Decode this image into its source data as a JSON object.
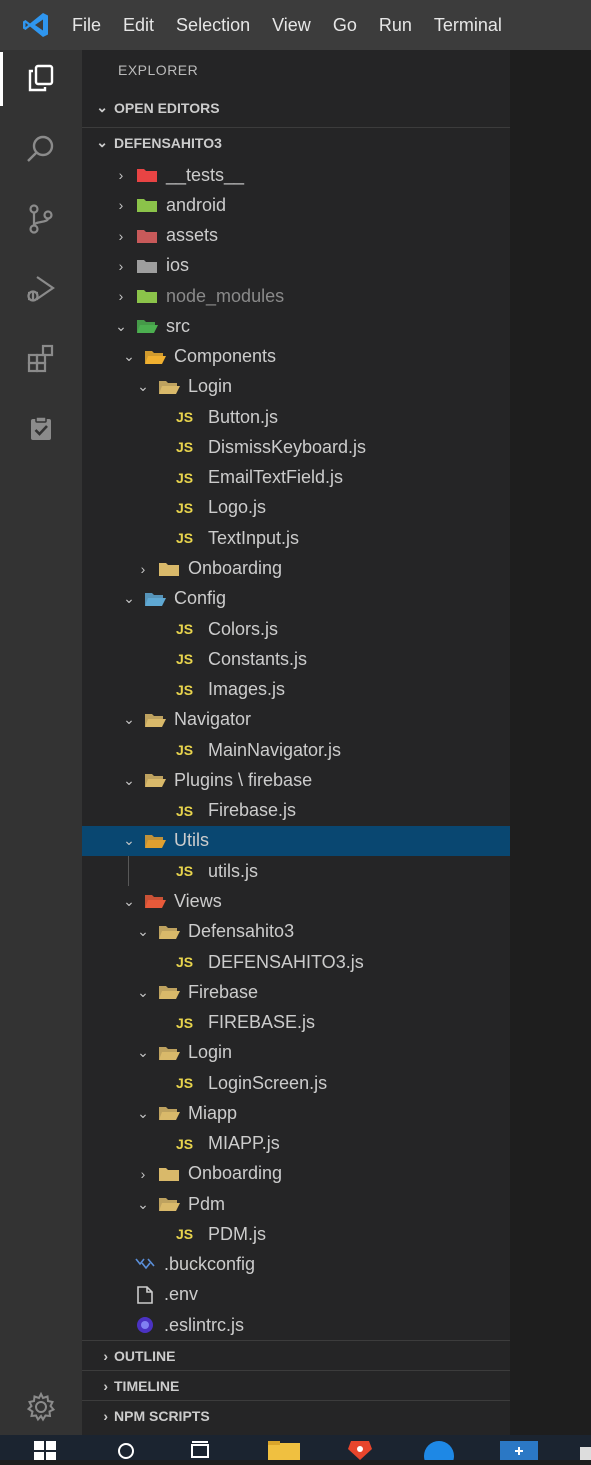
{
  "menubar": {
    "items": [
      "File",
      "Edit",
      "Selection",
      "View",
      "Go",
      "Run",
      "Terminal"
    ]
  },
  "activitybar": {
    "items": [
      "explorer-icon",
      "search-icon",
      "source-control-icon",
      "run-debug-icon",
      "extensions-icon",
      "checklist-icon"
    ],
    "bottom": "settings-gear-icon"
  },
  "sidebar": {
    "title": "EXPLORER",
    "open_editors": "OPEN EDITORS",
    "project": "DEFENSAHITO3",
    "tree": [
      {
        "label": "__tests__",
        "depth": 0,
        "kind": "folder",
        "expanded": false,
        "color": "#e84444"
      },
      {
        "label": "android",
        "depth": 0,
        "kind": "folder",
        "expanded": false,
        "color": "#8bc34a"
      },
      {
        "label": "assets",
        "depth": 0,
        "kind": "folder",
        "expanded": false,
        "color": "#c85a5a"
      },
      {
        "label": "ios",
        "depth": 0,
        "kind": "folder",
        "expanded": false,
        "color": "#9e9e9e"
      },
      {
        "label": "node_modules",
        "depth": 0,
        "kind": "folder",
        "expanded": false,
        "color": "#8bc34a",
        "dim": true
      },
      {
        "label": "src",
        "depth": 0,
        "kind": "folder",
        "expanded": true,
        "color": "#4caf50"
      },
      {
        "label": "Components",
        "depth": 1,
        "kind": "folder",
        "expanded": true,
        "color": "#f0b030"
      },
      {
        "label": "Login",
        "depth": 2,
        "kind": "folder",
        "expanded": true,
        "color": "#d9b96a"
      },
      {
        "label": "Button.js",
        "depth": 3,
        "kind": "js"
      },
      {
        "label": "DismissKeyboard.js",
        "depth": 3,
        "kind": "js"
      },
      {
        "label": "EmailTextField.js",
        "depth": 3,
        "kind": "js"
      },
      {
        "label": "Logo.js",
        "depth": 3,
        "kind": "js"
      },
      {
        "label": "TextInput.js",
        "depth": 3,
        "kind": "js"
      },
      {
        "label": "Onboarding",
        "depth": 2,
        "kind": "folder",
        "expanded": false,
        "color": "#d9b96a"
      },
      {
        "label": "Config",
        "depth": 1,
        "kind": "folder",
        "expanded": true,
        "color": "#5fa8d3"
      },
      {
        "label": "Colors.js",
        "depth": 2,
        "kind": "js"
      },
      {
        "label": "Constants.js",
        "depth": 2,
        "kind": "js"
      },
      {
        "label": "Images.js",
        "depth": 2,
        "kind": "js"
      },
      {
        "label": "Navigator",
        "depth": 1,
        "kind": "folder",
        "expanded": true,
        "color": "#d9b96a"
      },
      {
        "label": "MainNavigator.js",
        "depth": 2,
        "kind": "js"
      },
      {
        "label": "Plugins \\ firebase",
        "depth": 1,
        "kind": "folder",
        "expanded": true,
        "color": "#d9b96a"
      },
      {
        "label": "Firebase.js",
        "depth": 2,
        "kind": "js"
      },
      {
        "label": "Utils",
        "depth": 1,
        "kind": "folder",
        "expanded": true,
        "color": "#e0a030",
        "selected": true
      },
      {
        "label": "utils.js",
        "depth": 2,
        "kind": "js"
      },
      {
        "label": "Views",
        "depth": 1,
        "kind": "folder",
        "expanded": true,
        "color": "#e85a3a"
      },
      {
        "label": "Defensahito3",
        "depth": 2,
        "kind": "folder",
        "expanded": true,
        "color": "#d9b96a"
      },
      {
        "label": "DEFENSAHITO3.js",
        "depth": 3,
        "kind": "js"
      },
      {
        "label": "Firebase",
        "depth": 2,
        "kind": "folder",
        "expanded": true,
        "color": "#d9b96a"
      },
      {
        "label": "FIREBASE.js",
        "depth": 3,
        "kind": "js"
      },
      {
        "label": "Login",
        "depth": 2,
        "kind": "folder",
        "expanded": true,
        "color": "#d9b96a"
      },
      {
        "label": "LoginScreen.js",
        "depth": 3,
        "kind": "js"
      },
      {
        "label": "Miapp",
        "depth": 2,
        "kind": "folder",
        "expanded": true,
        "color": "#d9b96a"
      },
      {
        "label": "MIAPP.js",
        "depth": 3,
        "kind": "js"
      },
      {
        "label": "Onboarding",
        "depth": 2,
        "kind": "folder",
        "expanded": false,
        "color": "#d9b96a"
      },
      {
        "label": "Pdm",
        "depth": 2,
        "kind": "folder",
        "expanded": true,
        "color": "#d9b96a"
      },
      {
        "label": "PDM.js",
        "depth": 3,
        "kind": "js"
      },
      {
        "label": ".buckconfig",
        "depth": 0,
        "kind": "buck"
      },
      {
        "label": ".env",
        "depth": 0,
        "kind": "file"
      },
      {
        "label": ".eslintrc.js",
        "depth": 0,
        "kind": "eslint"
      }
    ],
    "sections": [
      "OUTLINE",
      "TIMELINE",
      "NPM SCRIPTS"
    ]
  },
  "taskbar": {
    "items": [
      "windows-start-icon",
      "search-icon",
      "task-view-icon",
      "file-explorer-icon",
      "brave-browser-icon",
      "app-icon",
      "vscode-taskbar-icon"
    ]
  },
  "colors": {
    "menubar": "#3c3c3c",
    "activitybar": "#333333",
    "sidebar": "#252526",
    "selection": "#094771",
    "js_badge": "#e8d44d"
  }
}
